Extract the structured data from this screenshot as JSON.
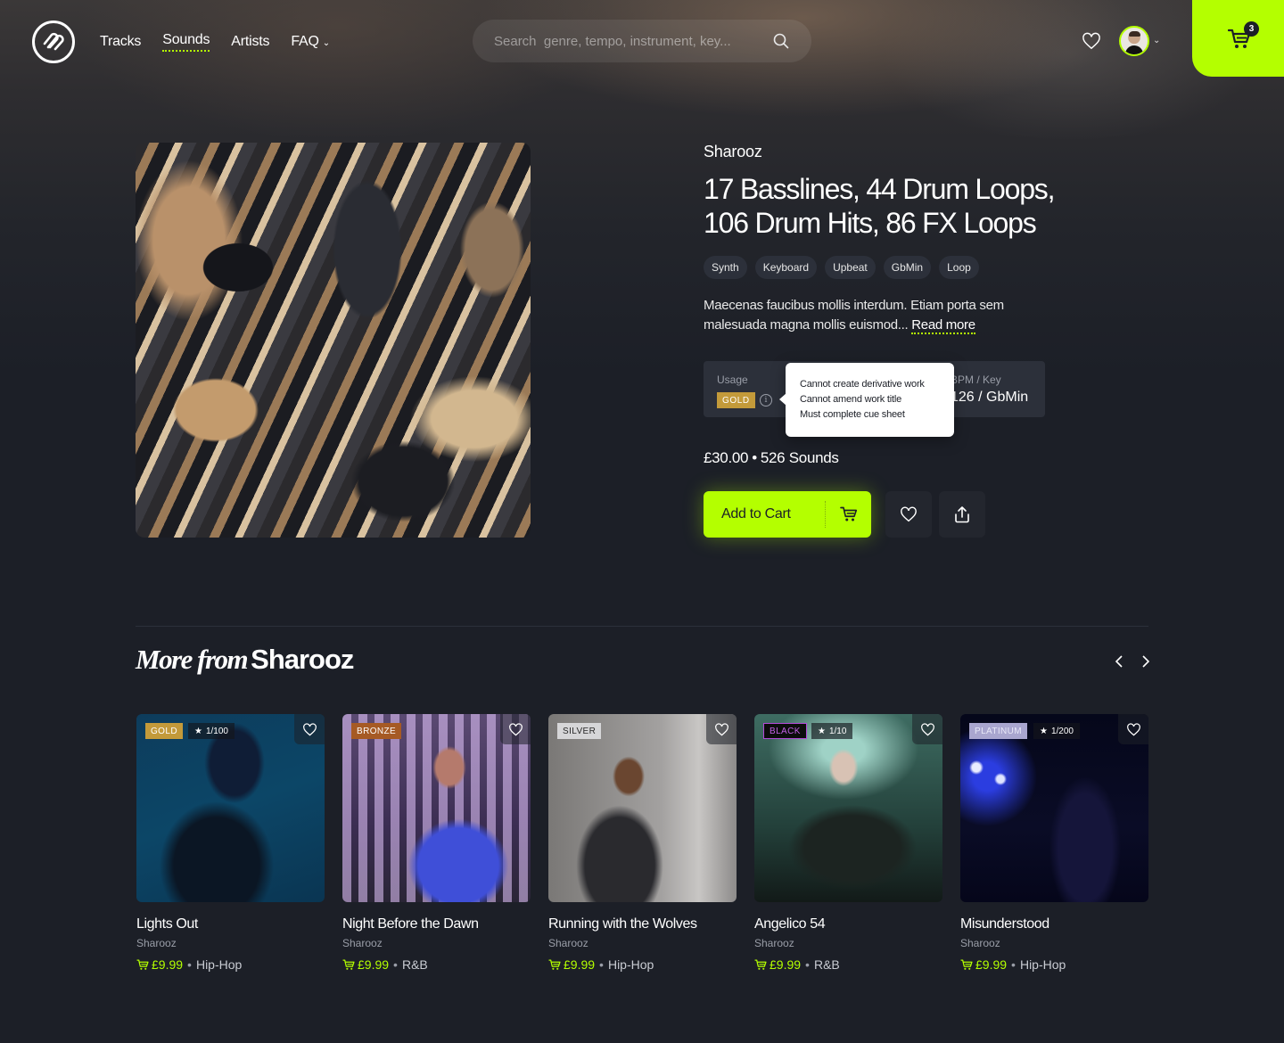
{
  "colors": {
    "accent": "#b4ff00",
    "background": "#1c1f27",
    "surface": "#2c303a",
    "tier_gold": "#c39a3a",
    "tier_bronze": "#a65a24",
    "tier_silver": "#d6d6d8",
    "tier_black": "#0c0c0c",
    "tier_platinum": "#a9a6cf"
  },
  "header": {
    "logo": "brand-logo",
    "nav": [
      {
        "label": "Tracks",
        "active": false
      },
      {
        "label": "Sounds",
        "active": true
      },
      {
        "label": "Artists",
        "active": false
      },
      {
        "label": "FAQ",
        "active": false,
        "has_dropdown": true
      }
    ],
    "search": {
      "placeholder": "Search  genre, tempo, instrument, key...",
      "value": ""
    },
    "cart_count": "3"
  },
  "product": {
    "artist": "Sharooz",
    "title": "17 Basslines, 44 Drum Loops, 106 Drum Hits, 86 FX Loops",
    "tags": [
      "Synth",
      "Keyboard",
      "Upbeat",
      "GbMin",
      "Loop"
    ],
    "description": "Maecenas faucibus mollis interdum. Etiam porta sem malesuada magna mollis euismod...",
    "read_more": "Read more",
    "usage_label": "Usage",
    "usage_tier": "GOLD",
    "bpm_key_label": "BPM / Key",
    "bpm_key_value": "126 / GbMin",
    "tooltip": [
      "Cannot create derivative work",
      "Cannot amend work title",
      "Must complete cue sheet"
    ],
    "price": "£30.00",
    "separator": "•",
    "sound_count": "526 Sounds",
    "add_to_cart": "Add to Cart"
  },
  "more_from": {
    "title_italic": "More from",
    "title_artist": "Sharooz",
    "cards": [
      {
        "tier": "GOLD",
        "tier_class": "gold",
        "edition": "1/100",
        "title": "Lights Out",
        "artist": "Sharooz",
        "price": "£9.99",
        "genre": "Hip-Hop"
      },
      {
        "tier": "BRONZE",
        "tier_class": "bronze",
        "edition": "",
        "title": "Night Before the Dawn",
        "artist": "Sharooz",
        "price": "£9.99",
        "genre": "R&B"
      },
      {
        "tier": "SILVER",
        "tier_class": "silver",
        "edition": "",
        "title": "Running with the Wolves",
        "artist": "Sharooz",
        "price": "£9.99",
        "genre": "Hip-Hop"
      },
      {
        "tier": "BLACK",
        "tier_class": "black",
        "edition": "1/10",
        "title": "Angelico 54",
        "artist": "Sharooz",
        "price": "£9.99",
        "genre": "R&B"
      },
      {
        "tier": "PLATINUM",
        "tier_class": "platinum",
        "edition": "1/200",
        "title": "Misunderstood",
        "artist": "Sharooz",
        "price": "£9.99",
        "genre": "Hip-Hop"
      }
    ]
  }
}
